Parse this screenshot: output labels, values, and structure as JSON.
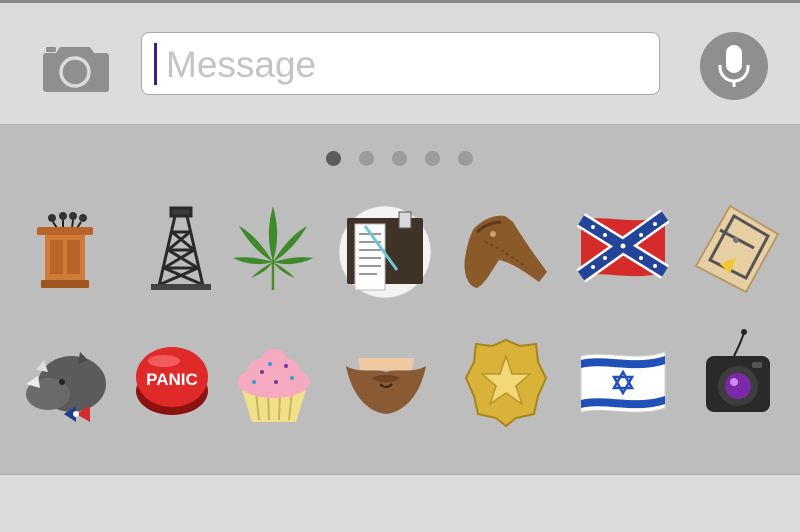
{
  "message_bar": {
    "placeholder": "Message",
    "camera_icon": "camera-icon",
    "mic_icon": "microphone-icon"
  },
  "pager": {
    "page_count": 5,
    "active_index": 0
  },
  "stickers": {
    "row1": [
      "podium-with-microphones",
      "oil-derrick",
      "cannabis-leaf",
      "clipboard-checklist",
      "leather-holster",
      "confederate-flag",
      "mousetrap-with-cheese"
    ],
    "row2": [
      "rhino-with-bowtie",
      "panic-button",
      "pink-cupcake",
      "brown-beard",
      "gold-sheriff-badge",
      "israel-flag",
      "camera-with-antenna"
    ]
  },
  "panic_button": {
    "label": "PANIC"
  },
  "colors": {
    "input_bar_bg": "#dcdcdc",
    "keyboard_bg": "#bdbdbd",
    "caret": "#3a1f8c",
    "active_dot": "#5c5c5c",
    "inactive_dot": "#9c9c9c"
  }
}
